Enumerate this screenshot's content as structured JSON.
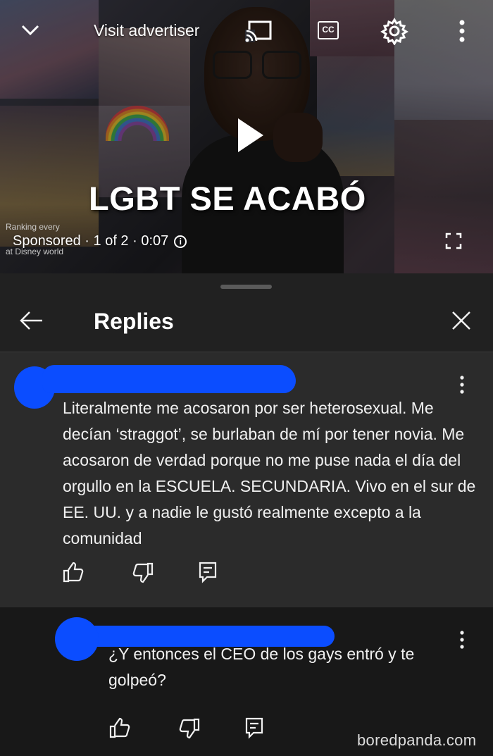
{
  "player": {
    "visit_label": "Visit advertiser",
    "cc_label": "CC",
    "video_title": "LGBT SE ACABÓ",
    "ranking_line1": "Ranking every",
    "ranking_line2": "at Disney world",
    "sponsored": "Sponsored · 1 of 2 · 0:07",
    "info_glyph": "i",
    "icons": [
      "chevron-down-icon",
      "cast-icon",
      "cc-icon",
      "settings-gear-icon",
      "more-vert-icon",
      "play-icon",
      "fullscreen-icon"
    ]
  },
  "panel": {
    "title": "Replies",
    "icons": [
      "back-arrow-icon",
      "close-icon"
    ]
  },
  "comments": [
    {
      "text": "Literalmente me acosaron por ser heterosexual. Me decían ‘straggot’, se burlaban de mí por tener novia. Me acosaron de verdad porque no me puse nada el día del orgullo en la ESCUELA. SECUNDARIA. Vivo en el sur de EE. UU. y a nadie le gustó realmente excepto a la comunidad",
      "icons": [
        "thumb-up-icon",
        "thumb-down-icon",
        "reply-icon",
        "more-vert-icon"
      ]
    },
    {
      "text": "¿Y entonces el CEO de los gays entró y te golpeó?",
      "icons": [
        "thumb-up-icon",
        "thumb-down-icon",
        "reply-icon",
        "more-vert-icon"
      ]
    }
  ],
  "watermark": "boredpanda.com",
  "colors": {
    "background": "#0f0f0f",
    "panel": "#212121",
    "comment_highlight": "#2b2b2b",
    "redaction_blue": "#0b4dff",
    "text": "#f1f1f1"
  }
}
